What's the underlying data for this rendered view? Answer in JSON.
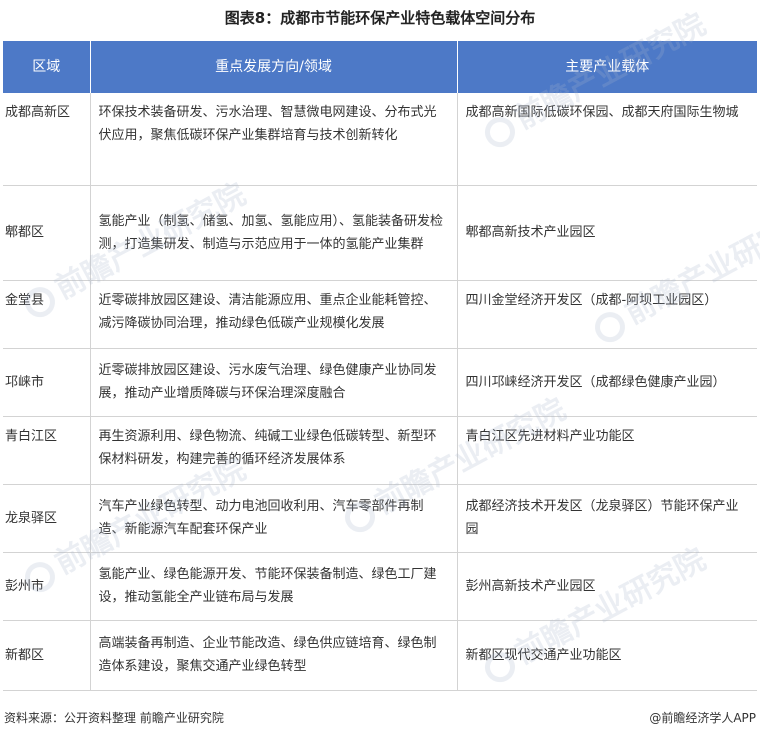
{
  "title": "图表8：成都市节能环保产业特色载体空间分布",
  "table": {
    "headers": [
      "区域",
      "重点发展方向/领域",
      "主要产业载体"
    ],
    "rows": [
      {
        "region": "成都高新区",
        "direction": "环保技术装备研发、污水治理、智慧微电网建设、分布式光伏应用，聚焦低碳环保产业集群培育与技术创新转化",
        "carrier": "成都高新国际低碳环保园、成都天府国际生物城"
      },
      {
        "region": "郫都区",
        "direction": "氢能产业（制氢、储氢、加氢、氢能应用）、氢能装备研发检测，打造集研发、制造与示范应用于一体的氢能产业集群",
        "carrier": "郫都高新技术产业园区"
      },
      {
        "region": "金堂县",
        "direction": "近零碳排放园区建设、清洁能源应用、重点企业能耗管控、减污降碳协同治理，推动绿色低碳产业规模化发展",
        "carrier": "四川金堂经济开发区（成都-阿坝工业园区）"
      },
      {
        "region": "邛崃市",
        "direction": "近零碳排放园区建设、污水废气治理、绿色健康产业协同发展，推动产业增质降碳与环保治理深度融合",
        "carrier": "四川邛崃经济开发区（成都绿色健康产业园）"
      },
      {
        "region": "青白江区",
        "direction": "再生资源利用、绿色物流、纯碱工业绿色低碳转型、新型环保材料研发，构建完善的循环经济发展体系",
        "carrier": "青白江区先进材料产业功能区"
      },
      {
        "region": "龙泉驿区",
        "direction": "汽车产业绿色转型、动力电池回收利用、汽车零部件再制造、新能源汽车配套环保产业",
        "carrier": "成都经济技术开发区（龙泉驿区）节能环保产业园"
      },
      {
        "region": "彭州市",
        "direction": "氢能产业、绿色能源开发、节能环保装备制造、绿色工厂建设，推动氢能全产业链布局与发展",
        "carrier": "彭州高新技术产业园区"
      },
      {
        "region": "新都区",
        "direction": "高端装备再制造、企业节能改造、绿色供应链培育、绿色制造体系建设，聚焦交通产业绿色转型",
        "carrier": "新都区现代交通产业功能区"
      }
    ]
  },
  "footer": {
    "source": "资料来源：公开资料整理 前瞻产业研究院",
    "brand": "@前瞻经济学人APP"
  },
  "watermark": {
    "text": "前瞻产业研究院",
    "icon": "qianzhan-logo-icon"
  },
  "colors": {
    "header_bg": "#4d79c7",
    "header_text": "#ffffff",
    "border": "#d3d3d3"
  }
}
